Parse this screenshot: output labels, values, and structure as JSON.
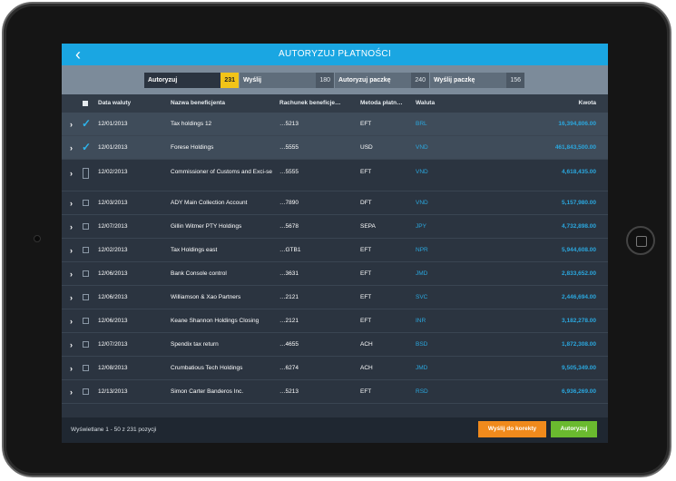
{
  "header": {
    "title": "AUTORYZUJ PŁATNOŚCI",
    "back_icon": "‹"
  },
  "segments": [
    {
      "label": "Autoryzuj",
      "count": "231",
      "active": true
    },
    {
      "label": "Wyślij",
      "count": "180",
      "active": false
    },
    {
      "label": "Autoryzuj paczkę",
      "count": "240",
      "active": false
    },
    {
      "label": "Wyślij paczkę",
      "count": "156",
      "active": false
    }
  ],
  "columns": {
    "date": "Data waluty",
    "name": "Nazwa beneficjenta",
    "account": "Rachunek beneficje…",
    "method": "Metoda płatn…",
    "currency": "Waluta",
    "amount": "Kwota"
  },
  "rows": [
    {
      "checked": true,
      "date": "12/01/2013",
      "name": "Tax holdings 12",
      "account": "…5213",
      "method": "EFT",
      "currency": "BRL",
      "amount": "16,394,806.00"
    },
    {
      "checked": true,
      "date": "12/01/2013",
      "name": "Forese Holdings",
      "account": "…5555",
      "method": "USD",
      "currency": "VND",
      "amount": "461,843,500.00"
    },
    {
      "checked": false,
      "date": "12/02/2013",
      "name": "Commissioner of Customs and Exci-se",
      "account": "…5555",
      "method": "EFT",
      "currency": "VND",
      "amount": "4,618,435.00"
    },
    {
      "checked": false,
      "date": "12/03/2013",
      "name": "ADY Main Collection Account",
      "account": "…7890",
      "method": "DFT",
      "currency": "VND",
      "amount": "5,157,980.00"
    },
    {
      "checked": false,
      "date": "12/07/2013",
      "name": "Gillin Witmer PTY Holdings",
      "account": "…5678",
      "method": "SEPA",
      "currency": "JPY",
      "amount": "4,732,898.00"
    },
    {
      "checked": false,
      "date": "12/02/2013",
      "name": "Tax Holdings east",
      "account": "…GTB1",
      "method": "EFT",
      "currency": "NPR",
      "amount": "5,944,608.00"
    },
    {
      "checked": false,
      "date": "12/06/2013",
      "name": "Bank Console control",
      "account": "…3631",
      "method": "EFT",
      "currency": "JMD",
      "amount": "2,833,652.00"
    },
    {
      "checked": false,
      "date": "12/06/2013",
      "name": "Williamson & Xao Partners",
      "account": "…2121",
      "method": "EFT",
      "currency": "SVC",
      "amount": "2,446,694.00"
    },
    {
      "checked": false,
      "date": "12/06/2013",
      "name": "Keane Shannon Holdings Closing",
      "account": "…2121",
      "method": "EFT",
      "currency": "INR",
      "amount": "3,182,278.00"
    },
    {
      "checked": false,
      "date": "12/07/2013",
      "name": "Spendix tax return",
      "account": "…4655",
      "method": "ACH",
      "currency": "BSD",
      "amount": "1,872,308.00"
    },
    {
      "checked": false,
      "date": "12/08/2013",
      "name": "Crumbatious Tech Holdings",
      "account": "…6274",
      "method": "ACH",
      "currency": "JMD",
      "amount": "9,505,349.00"
    },
    {
      "checked": false,
      "date": "12/13/2013",
      "name": "Simon Carter Banderos Inc.",
      "account": "…5213",
      "method": "EFT",
      "currency": "RSD",
      "amount": "6,936,269.00"
    }
  ],
  "footer": {
    "status": "Wyświetlane 1 - 50 z 231 pozycji",
    "send_label": "Wyślij do korekty",
    "authorize_label": "Autoryzuj"
  },
  "colors": {
    "accent": "#1aa6e2",
    "highlight": "#f2c418",
    "send": "#f08a1c",
    "authorize": "#6aba2f"
  }
}
